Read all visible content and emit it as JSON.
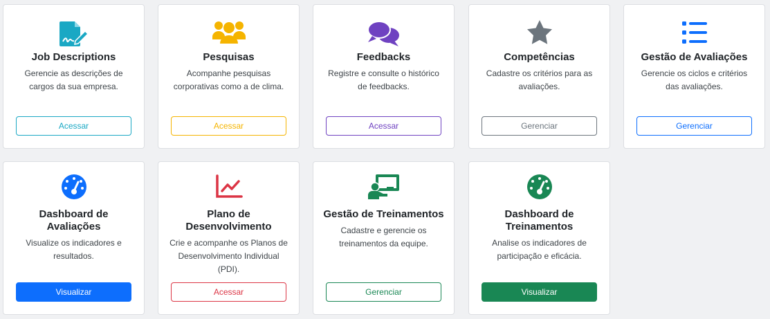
{
  "colors": {
    "teal": "#1aa8c4",
    "amber": "#f5b400",
    "purple": "#6f42c1",
    "gray": "#6c757d",
    "blue": "#0d6efd",
    "red": "#dc3545",
    "green": "#198754"
  },
  "cards": [
    {
      "title": "Job Descriptions",
      "description": "Gerencie as descrições de cargos da sua empresa.",
      "button": "Acessar",
      "icon": "file-signature-icon"
    },
    {
      "title": "Pesquisas",
      "description": "Acompanhe pesquisas corporativas como a de clima.",
      "button": "Acessar",
      "icon": "users-icon"
    },
    {
      "title": "Feedbacks",
      "description": "Registre e consulte o histórico de feedbacks.",
      "button": "Acessar",
      "icon": "comments-icon"
    },
    {
      "title": "Competências",
      "description": "Cadastre os critérios para as avaliações.",
      "button": "Gerenciar",
      "icon": "star-icon"
    },
    {
      "title": "Gestão de Avaliações",
      "description": "Gerencie os ciclos e critérios das avaliações.",
      "button": "Gerenciar",
      "icon": "list-icon"
    },
    {
      "title": "Dashboard de Avaliações",
      "description": "Visualize os indicadores e resultados.",
      "button": "Visualizar",
      "icon": "gauge-icon"
    },
    {
      "title": "Plano de Desenvolvimento",
      "description": "Crie e acompanhe os Planos de Desenvolvimento Individual (PDI).",
      "button": "Acessar",
      "icon": "chart-line-icon"
    },
    {
      "title": "Gestão de Treinamentos",
      "description": "Cadastre e gerencie os treinamentos da equipe.",
      "button": "Gerenciar",
      "icon": "chalkboard-teacher-icon"
    },
    {
      "title": "Dashboard de Treinamentos",
      "description": "Analise os indicadores de participação e eficácia.",
      "button": "Visualizar",
      "icon": "gauge-icon"
    }
  ]
}
